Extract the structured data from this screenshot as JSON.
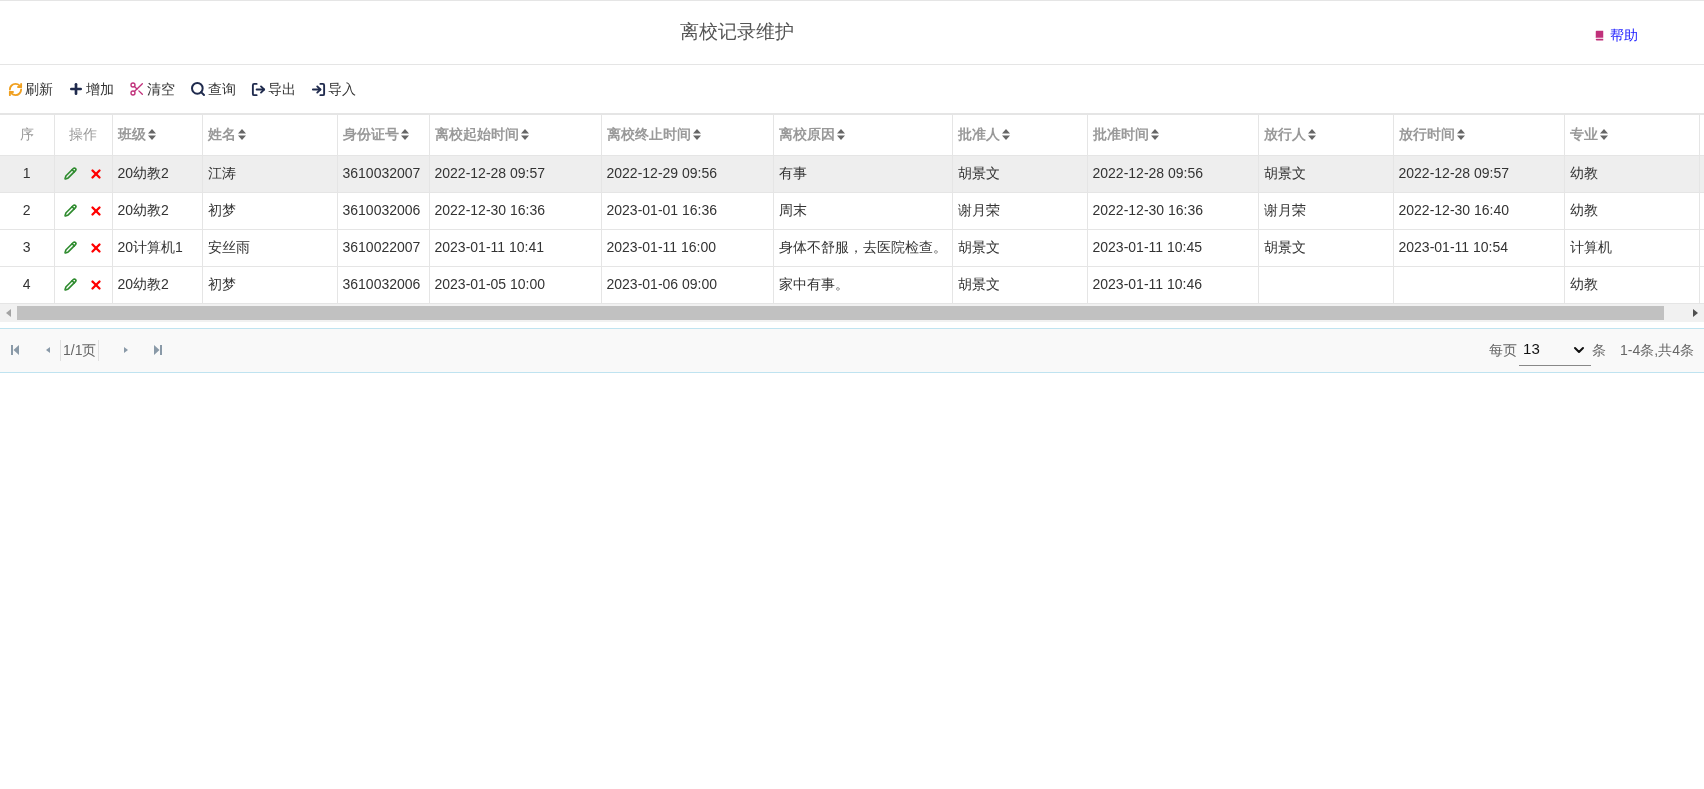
{
  "page_title": "离校记录维护",
  "help_link": "帮助",
  "toolbar": [
    {
      "kind": "refresh",
      "label": "刷新"
    },
    {
      "kind": "add",
      "label": "增加"
    },
    {
      "kind": "clear",
      "label": "清空"
    },
    {
      "kind": "search",
      "label": "查询"
    },
    {
      "kind": "export",
      "label": "导出"
    },
    {
      "kind": "import",
      "label": "导入"
    }
  ],
  "table": {
    "columns": [
      {
        "label": "序",
        "sortable": false
      },
      {
        "label": "操作",
        "sortable": false
      },
      {
        "label": "班级",
        "sortable": true
      },
      {
        "label": "姓名",
        "sortable": true
      },
      {
        "label": "身份证号",
        "sortable": true
      },
      {
        "label": "离校起始时间",
        "sortable": true
      },
      {
        "label": "离校终止时间",
        "sortable": true
      },
      {
        "label": "离校原因",
        "sortable": true
      },
      {
        "label": "批准人",
        "sortable": true
      },
      {
        "label": "批准时间",
        "sortable": true
      },
      {
        "label": "放行人",
        "sortable": true
      },
      {
        "label": "放行时间",
        "sortable": true
      },
      {
        "label": "专业",
        "sortable": true
      }
    ],
    "rows": [
      {
        "selected": true,
        "cells": [
          "1",
          "",
          "20幼教2",
          "江涛",
          "3610032007",
          "2022-12-28 09:57",
          "2022-12-29 09:56",
          "有事",
          "胡景文",
          "2022-12-28 09:56",
          "胡景文",
          "2022-12-28 09:57",
          "幼教"
        ]
      },
      {
        "selected": false,
        "cells": [
          "2",
          "",
          "20幼教2",
          "初梦",
          "3610032006",
          "2022-12-30 16:36",
          "2023-01-01 16:36",
          "周末",
          "谢月荣",
          "2022-12-30 16:36",
          "谢月荣",
          "2022-12-30 16:40",
          "幼教"
        ]
      },
      {
        "selected": false,
        "cells": [
          "3",
          "",
          "20计算机1",
          "安丝雨",
          "3610022007",
          "2023-01-11 10:41",
          "2023-01-11 16:00",
          "身体不舒服，去医院检查。",
          "胡景文",
          "2023-01-11 10:45",
          "胡景文",
          "2023-01-11 10:54",
          "计算机"
        ]
      },
      {
        "selected": false,
        "cells": [
          "4",
          "",
          "20幼教2",
          "初梦",
          "3610032006",
          "2023-01-05 10:00",
          "2023-01-06 09:00",
          "家中有事。",
          "胡景文",
          "2023-01-11 10:46",
          "",
          "",
          "幼教"
        ]
      }
    ]
  },
  "pagination": {
    "page": "1/1页",
    "per_page_label": "每页",
    "per_page": "13",
    "unit": "条",
    "summary": "1-4条,共4条"
  }
}
